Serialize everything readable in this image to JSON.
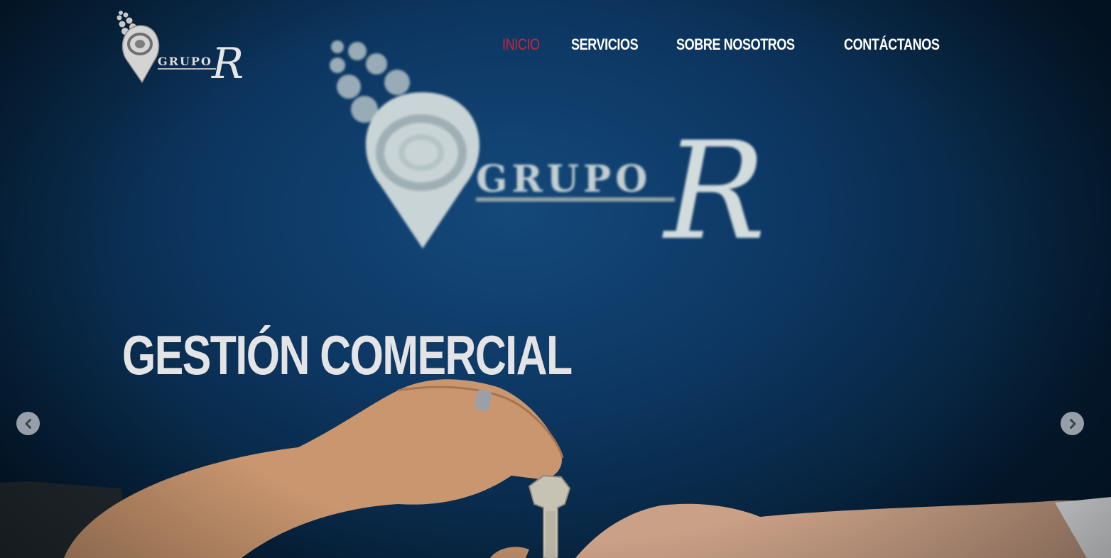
{
  "brand": {
    "logo_word": "GRUPO",
    "logo_letter": "R"
  },
  "nav": {
    "items": [
      {
        "label": "INICIO",
        "active": true
      },
      {
        "label": "SERVICIOS",
        "active": false
      },
      {
        "label": "SOBRE NOSOTROS",
        "active": false
      },
      {
        "label": "CONTÁCTANOS",
        "active": false
      }
    ],
    "active_color": "#d1233b"
  },
  "slide": {
    "headline": "GESTIÓN COMERCIAL"
  },
  "carousel": {
    "prev_icon": "chevron-left-icon",
    "next_icon": "chevron-right-icon"
  }
}
